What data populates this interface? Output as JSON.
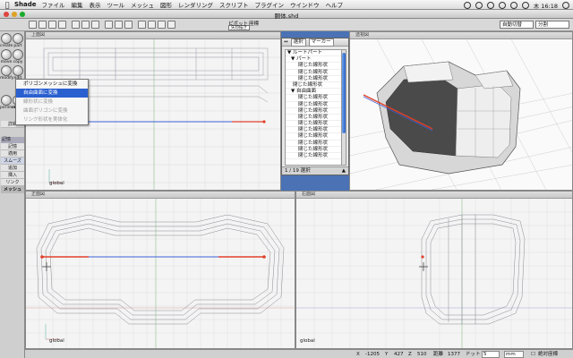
{
  "menubar": {
    "app_name": "Shade",
    "items": [
      "ファイル",
      "編集",
      "表示",
      "ツール",
      "メッシュ",
      "図形",
      "レンダリング",
      "スクリプト",
      "プラグイン",
      "ウインドウ",
      "ヘルプ"
    ],
    "clock": "木 16:18"
  },
  "window": {
    "title": "胴体.shd"
  },
  "toolbar": {
    "pivot_label": "ピボット",
    "pivot_mode": "矢印描き",
    "coord_label": "座標",
    "auto_switch": "自動切替",
    "split_label": "分割"
  },
  "palette": {
    "tools": [
      "create",
      "part",
      "move",
      "copy",
      "modify",
      "edit",
      "perimeter",
      "sweep"
    ],
    "section_label": "記憶",
    "rows": [
      "記憶",
      "適用",
      "スムーズ",
      "追加",
      "挿入",
      "リンク",
      "メッシュ"
    ],
    "top_rows": [
      "詳細"
    ]
  },
  "context_menu": {
    "items": [
      {
        "label": "ポリゴンメッシュに変換",
        "state": "normal"
      },
      {
        "label": "自由曲面に変換",
        "state": "selected"
      },
      {
        "label": "線形状に変換",
        "state": "disabled"
      },
      {
        "label": "曲面ポリゴンに変換",
        "state": "disabled"
      },
      {
        "label": "リンク形状を実体化",
        "state": "disabled"
      }
    ]
  },
  "browser": {
    "select_label": "選択",
    "marker_label": "マーカー",
    "rows": [
      "ルートパート",
      "パート",
      "閉じた線形状",
      "閉じた線形状",
      "閉じた線形状",
      "閉じた線形状",
      "自由曲面",
      "閉じた線形状",
      "閉じた線形状",
      "閉じた線形状",
      "閉じた線形状",
      "閉じた線形状",
      "閉じた線形状",
      "閉じた線形状",
      "閉じた線形状",
      "閉じた線形状",
      "閉じた線形状"
    ],
    "selection_count": "1 / 19 選択"
  },
  "viewports": {
    "top": {
      "title": "上面図",
      "label": "global"
    },
    "perspective": {
      "title": "透視図"
    },
    "front": {
      "title": "正面図",
      "label": "global"
    },
    "side": {
      "title": "右面図",
      "label": "global"
    }
  },
  "status": {
    "x_label": "X",
    "x_value": "-1205",
    "y_label": "Y",
    "y_value": "427",
    "z_label": "Z",
    "z_value": "510",
    "dist_label": "距離",
    "dist_value": "1377",
    "dot_label": "ドット",
    "dot_value": "5",
    "unit": "mm",
    "coord_mode": "絶対座標"
  },
  "colors": {
    "accent": "#2a5fd0",
    "desktop": "#4a72b4",
    "selected_edge": "#e0402a",
    "line_blue": "#3c5fd8"
  }
}
